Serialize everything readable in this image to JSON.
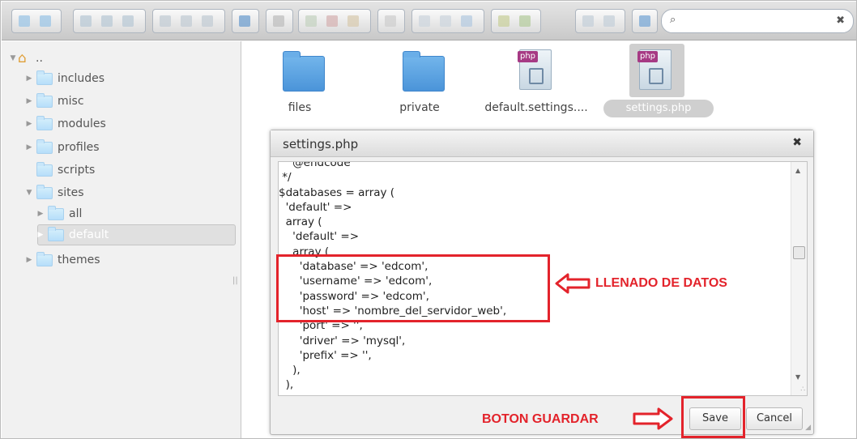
{
  "toolbar": {
    "buttons": [
      "back-icon",
      "forward-icon",
      "home-icon",
      "reload-icon",
      "save-icon",
      "copy-icon",
      "paste-icon",
      "select-icon",
      "info-icon",
      "view-icon",
      "new-file-icon",
      "cut-icon",
      "delete-icon",
      "rename-icon",
      "duplicate-icon",
      "archive-icon",
      "move-icon",
      "resize-icon",
      "extract-icon",
      "upload-icon",
      "icons-view-icon",
      "list-view-icon",
      "help-icon"
    ],
    "search": {
      "placeholder": "",
      "value": ""
    }
  },
  "sidebar": {
    "root_label": "..",
    "items": [
      {
        "label": "includes"
      },
      {
        "label": "misc"
      },
      {
        "label": "modules"
      },
      {
        "label": "profiles"
      },
      {
        "label": "scripts"
      },
      {
        "label": "sites"
      },
      {
        "label": "all"
      },
      {
        "label": "default"
      },
      {
        "label": "themes"
      }
    ]
  },
  "files": [
    {
      "name": "files",
      "type": "folder"
    },
    {
      "name": "private",
      "type": "folder"
    },
    {
      "name": "default.settings....",
      "type": "php",
      "badge": "php"
    },
    {
      "name": "settings.php",
      "type": "php",
      "badge": "php"
    }
  ],
  "dialog": {
    "title": "settings.php",
    "code": [
      "    @endcode",
      " */",
      "$databases = array (",
      "  'default' =>",
      "  array (",
      "    'default' =>",
      "    array (",
      "      'database' => 'edcom',",
      "      'username' => 'edcom',",
      "      'password' => 'edcom',",
      "      'host' => 'nombre_del_servidor_web',",
      "      'port' => '',",
      "      'driver' => 'mysql',",
      "      'prefix' => '',",
      "    ),",
      "  ),",
      ");"
    ],
    "save_label": "Save",
    "cancel_label": "Cancel"
  },
  "annotations": {
    "fill_label": "LLENADO DE DATOS",
    "save_hint": "BOTON GUARDAR",
    "color": "#e3232b"
  }
}
